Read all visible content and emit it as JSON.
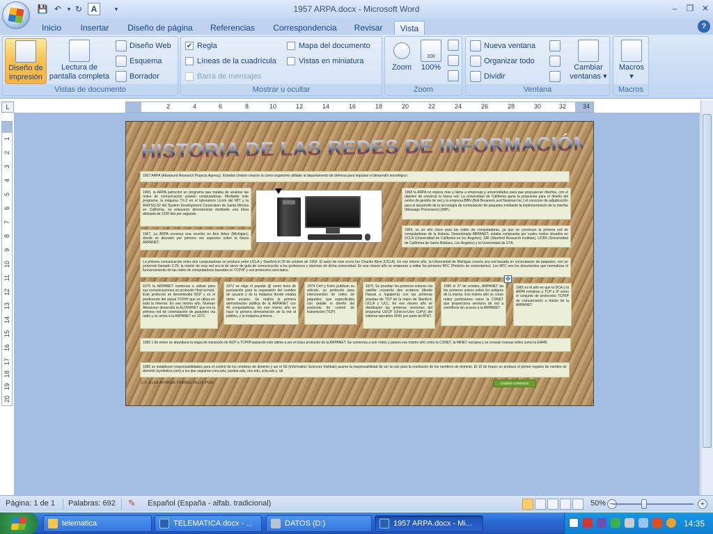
{
  "window": {
    "title": "1957  ARPA.docx - Microsoft Word"
  },
  "ribbon_tabs": [
    "Inicio",
    "Insertar",
    "Diseño de página",
    "Referencias",
    "Correspondencia",
    "Revisar",
    "Vista"
  ],
  "ribbon_active_tab": "Vista",
  "groups": {
    "vistas": {
      "label": "Vistas de documento",
      "diseno_impresion_line1": "Diseño de",
      "diseno_impresion_line2": "impresión",
      "lectura_line1": "Lectura de",
      "lectura_line2": "pantalla completa",
      "diseno_web": "Diseño Web",
      "esquema": "Esquema",
      "borrador": "Borrador"
    },
    "mostrar": {
      "label": "Mostrar u ocultar",
      "regla": "Regla",
      "regla_checked": "✔",
      "lineas": "Líneas de la cuadrícula",
      "barra": "Barra de mensajes",
      "mapa": "Mapa del documento",
      "miniatura": "Vistas en miniatura"
    },
    "zoom": {
      "label": "Zoom",
      "zoom": "Zoom",
      "cien": "100%",
      "cien_icon": "100"
    },
    "ventana": {
      "label": "Ventana",
      "nueva": "Nueva ventana",
      "organizar": "Organizar todo",
      "dividir": "Dividir",
      "cambiar_line1": "Cambiar",
      "cambiar_line2": "ventanas ▾"
    },
    "macros": {
      "label": "Macros",
      "macros": "Macros",
      "macros_arrow": "▾"
    }
  },
  "rulers": {
    "corner": "L",
    "h_ticks": [
      "2",
      "4",
      "6",
      "8",
      "10",
      "12",
      "14",
      "16",
      "18",
      "20",
      "22",
      "24",
      "26",
      "28",
      "30",
      "32",
      "34"
    ],
    "v_ticks": [
      "1",
      "2",
      "3",
      "4",
      "5",
      "6",
      "7",
      "8",
      "9",
      "10",
      "11",
      "12",
      "13",
      "14",
      "15",
      "16",
      "17",
      "18",
      "19",
      "20"
    ]
  },
  "document": {
    "title": "HISTORIA DE LAS REDES DE INFORMACIÓN",
    "b1957": "1957 ARPA (Advanced Research Projects Agency). Estados Unidos crearon la como organismo afiliado al departamento de defensa para impulsar el desarrollo tecnológico.",
    "b1965": "1965, la ARPA patrocinó un programa que trataba de analizar las redes de comunicación usando computadoras. Mediante este programa, la máquina TX-2 en el laboratorio Licoln del MIT y la AN/FSQ-32 del System Development Corporation de Santa Mónica en California, se enlazaron directamente mediante una línea delicada de 1200 bits por segundo.",
    "b1967": "1967, La ARPA convoca una reunión en Ann Arbor (Michigan), donde se discuten por primera vez aspectos sobre la futura ARPANET.",
    "b1968a": "1968 la ARPA no espera más y llama a empresas y universidades para que propusieran diseños, con el objetivo de construir la futura red. La universidad de California gana la propuesta para el diseño del centro de gestión de red y la empresa BBN (Bolt Beraneck and Newman Inc.) el concurso de adjudicación para el desarrollo de la tecnología de conmutación de paquetes mediante la implementación de la interfaz (Message Processors) (IMP).",
    "b1968b": "1969, es un año clave para las redes de computadoras, ya que se construye la primera red de computadoras de la historia. Denominada ARPANET, estaba compuesta por cuatro nodos situados en UCLA (Universidad de California en los Ángeles), SRI (Stanford Research Institute), UCBS (Universidad de California de Santa Bárbara, Los Ángeles) y la Universidad de UTA.",
    "bwide": "La primera comunicación entre dos computadoras se produce entre UCLA y Stanford el 20 de octubre de 1969. El autor de este envío fue Charles Kline (UCLA). En ese mismo año, la Universidad de Michigan crearía una red basada en conmutación de paquetes, con un protocolo llamado X.25, la misión de esta red era la de servir de guía de comunicación a los profesores y alumnos de dicha universidad. En ese mismo año se empiezan a editar los primeros RFC (Petición de comentarios). Los RFC son los documentos que normalizan el funcionamiento de las redes de computadoras basadas en TCP/IP y sus protocolos asociados.",
    "b1970": "1970 la ARPANET comienza a utilizar para sus comunicaciones un protocolo Host-to-host. Este protocolo se denominaba NCP y es el predecesor del actual TCP/IP que se utiliza en toda la Internet. En ese mismo año, Norman Abramson desarrolla la ALOHANET que era la primera red de conmutación de paquetes vía radio y se uniría a la ARPANET en 1972.",
    "b1972": "1972 se elige el popular @ como tecla de puntuación para la separación del nombre de usuario y de la máquina donde estaba dicho usuario. Se realiza la primera demostración pública de la ARPANET con 40 computadoras. En ese mismo año se hace la primera demostración de la red al público, y la máquina primera...",
    "b1974": "1974 Cerf y Kahn publican su artículo, un protocolo para interconexión de redes de paquetes, que especificaba con detalle el diseño del protocolo de control de transmisión (TCP).",
    "b1975": "1975, Se prueban los primeros enlaces vía satélite cruzando dos océanos (desde Hawaii a Inglaterra) con las primeras pruebas de TCP de la mano de Stanford, UCLA y UCL. En ese mismo año se distribuyen las primeras versiones del programa UUCP (Unix-to-Unix CoPy) del sistema operativo UNIX por parte de AT&T.",
    "b1980": "1980 el 27 de octubre, ARPANET da los primeros avisos sobre los peligros de la misma. Ese mismo año se crean redes particulares como la CSNET que proporciona servicios de red a científicos sin acceso a la ARPANET.",
    "b1982": "1982 es el año en que la DCA y la ARPA nombran a TCP e IP como el conjunto de protocolos TCP/IP de comunicación a través de la ARPANET.",
    "b1983": "1983 1 de enero se abandona la etapa de transición de NCP a TCP/IP pasando este último a ser el único protocolo de la ARPANET. Se comienza a unir redes y países ese mismo año como la CSNET, la MINET europea y se crearán nuevas redes como la EARN.",
    "b1985": "1985 se establecen responsabilidades para el control de los nombres de dominio y así el ISI (Information Sciences Institute) asume la responsabilidad de ser la raíz para la resolución de los nombres de dominio. El 15 de marzo se produce el primer registro de nombre de dominio (symbolics.com) a los que seguirían cmu.edu, purdue.edu, rice.edu, ucla.edu y .uk",
    "author": "LIT. ELSA AYORGA TORRES FELIX POR",
    "cc_logo": "creative commons"
  },
  "statusbar": {
    "pagina": "Página: 1 de 1",
    "palabras": "Palabras: 692",
    "idioma": "Español (España - alfab. tradicional)",
    "zoom": "50%",
    "minus": "−",
    "plus": "+"
  },
  "taskbar": {
    "tasks": [
      "telematica",
      "TELEMATICA.docx - ...",
      "DATOS (D:)",
      "1957  ARPA.docx - Mi..."
    ],
    "active_task": "1957  ARPA.docx - Mi...",
    "clock": "14:35"
  },
  "colors": {
    "ribbon_bg": "#c7dbf4",
    "page_bg": "#b28e60",
    "box_bg": "#ecefd7",
    "taskbar": "#2a69d4",
    "active_view": "#f8c14f"
  }
}
